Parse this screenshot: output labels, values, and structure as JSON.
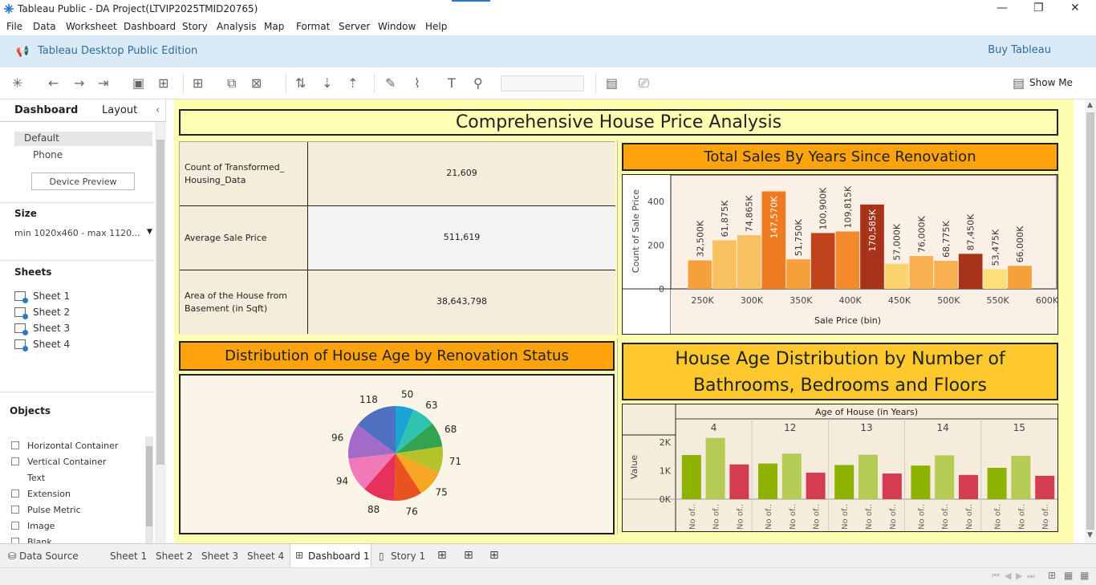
{
  "window": {
    "title": "Tableau Public - DA Project(LTVIP2025TMID20765)"
  },
  "menu": [
    "File",
    "Data",
    "Worksheet",
    "Dashboard",
    "Story",
    "Analysis",
    "Map",
    "Format",
    "Server",
    "Window",
    "Help"
  ],
  "banner": {
    "edition": "Tableau Desktop Public Edition",
    "buy": "Buy Tableau"
  },
  "toolbar": {
    "show_me": "Show Me"
  },
  "left": {
    "tab_dashboard": "Dashboard",
    "tab_layout": "Layout",
    "device_default": "Default",
    "device_phone": "Phone",
    "device_preview": "Device Preview",
    "size_title": "Size",
    "size_value": "min 1020x460 - max 1120...",
    "sheets_title": "Sheets",
    "sheets": [
      "Sheet 1",
      "Sheet 2",
      "Sheet 3",
      "Sheet 4"
    ],
    "objects_title": "Objects",
    "objects": [
      "Horizontal Container",
      "Vertical Container",
      "Text",
      "Extension",
      "Pulse Metric",
      "Image",
      "Blank"
    ]
  },
  "dashboard": {
    "title": "Comprehensive House Price Analysis",
    "kpis": [
      {
        "label": "Count of Transformed_ Housing_Data",
        "value": "21,609"
      },
      {
        "label": "Average Sale Price",
        "value": "511,619"
      },
      {
        "label": "Area of the House from Basement (in Sqft)",
        "value": "38,643,798"
      }
    ],
    "bar_title": "Total Sales By Years Since Renovation",
    "pie_title": "Distribution of House Age by Renovation Status",
    "grouped_title": "House Age Distribution by Number of Bathrooms, Bedrooms and Floors"
  },
  "colors": {
    "header_orange": "#ffa30d",
    "header_yellow": "#ffc92e",
    "dash_bg": "#fffeb0"
  },
  "chart_data": [
    {
      "type": "bar",
      "xlabel": "Sale Price (bin)",
      "ylabel": "Count of Sale Price",
      "ylim": [
        0,
        520
      ],
      "yticks": [
        0,
        200,
        400
      ],
      "xticks": [
        "250K",
        "300K",
        "350K",
        "400K",
        "450K",
        "500K",
        "550K",
        "600K"
      ],
      "bins": [
        225,
        250,
        275,
        300,
        325,
        350,
        375,
        400,
        425,
        450,
        475,
        500,
        525,
        550,
        575,
        600
      ],
      "values": [
        130,
        222,
        245,
        445,
        135,
        255,
        262,
        385,
        115,
        150,
        128,
        160,
        90,
        105
      ],
      "labels": [
        "32,500K",
        "61,875K",
        "74,865K",
        "147,570K",
        "51,750K",
        "100,900K",
        "109,815K",
        "170,585K",
        "57,000K",
        "76,000K",
        "68,775K",
        "87,450K",
        "53,475K",
        "66,000K"
      ],
      "colors": [
        "#f5a03a",
        "#f8c060",
        "#f8c060",
        "#ef7a22",
        "#f5a03a",
        "#c0431c",
        "#f28a2c",
        "#a8321a",
        "#fbd36f",
        "#f8b050",
        "#f8b050",
        "#a8321a",
        "#fde07a",
        "#f5a03a"
      ]
    },
    {
      "type": "pie",
      "labels": [
        "50",
        "63",
        "68",
        "71",
        "75",
        "76",
        "88",
        "94",
        "96",
        "118"
      ],
      "values": [
        50,
        63,
        68,
        71,
        75,
        76,
        88,
        94,
        96,
        118
      ],
      "colors": [
        "#1aa3d4",
        "#2ec4b0",
        "#33a34f",
        "#b5c22a",
        "#f5a623",
        "#e8531f",
        "#e6325a",
        "#f07ab8",
        "#a26bc8",
        "#4f6fc0"
      ]
    },
    {
      "type": "bar",
      "title": "Age of House (in Years)",
      "ylabel": "Value",
      "ylim": [
        0,
        2200
      ],
      "yticks": [
        "0K",
        "1K",
        "2K"
      ],
      "categories": [
        "4",
        "12",
        "13",
        "14",
        "15"
      ],
      "bar_label": "No of..",
      "series": [
        {
          "values": [
            1550,
            2150,
            1220
          ],
          "colors": [
            "#8db300",
            "#b4cb55",
            "#d43c52"
          ]
        },
        {
          "values": [
            1250,
            1600,
            930
          ],
          "colors": [
            "#8db300",
            "#b4cb55",
            "#d43c52"
          ]
        },
        {
          "values": [
            1200,
            1560,
            900
          ],
          "colors": [
            "#8db300",
            "#b4cb55",
            "#d43c52"
          ]
        },
        {
          "values": [
            1180,
            1540,
            850
          ],
          "colors": [
            "#8db300",
            "#b4cb55",
            "#d43c52"
          ]
        },
        {
          "values": [
            1100,
            1520,
            820
          ],
          "colors": [
            "#8db300",
            "#b4cb55",
            "#d43c52"
          ]
        }
      ]
    }
  ],
  "bottom_tabs": [
    "Data Source",
    "Sheet 1",
    "Sheet 2",
    "Sheet 3",
    "Sheet 4",
    "Dashboard 1",
    "Story 1"
  ]
}
